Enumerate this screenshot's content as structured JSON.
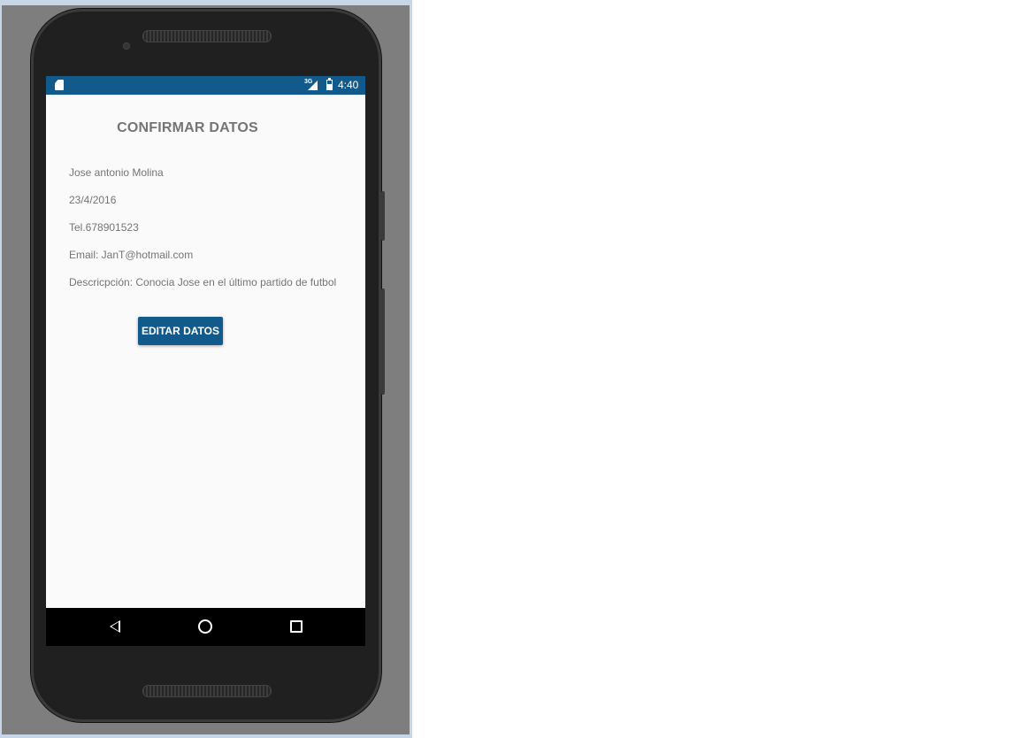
{
  "status_bar": {
    "network": "3G",
    "time": "4:40",
    "icons": [
      "sd-card-icon",
      "signal-icon",
      "battery-icon"
    ]
  },
  "screen": {
    "title": "CONFIRMAR DATOS",
    "fields": {
      "name": "Jose antonio Molina",
      "date": "23/4/2016",
      "phone": "Tel.678901523",
      "email": "Email: JanT@hotmail.com",
      "description": "Descricpción: Conocia Jose en el último partido de futbol"
    },
    "edit_button": "EDITAR DATOS"
  },
  "nav_bar": {
    "icons": [
      "back-icon",
      "home-icon",
      "recents-icon"
    ]
  },
  "colors": {
    "accent": "#135a8c",
    "text": "#757575",
    "background": "#fafafa"
  }
}
